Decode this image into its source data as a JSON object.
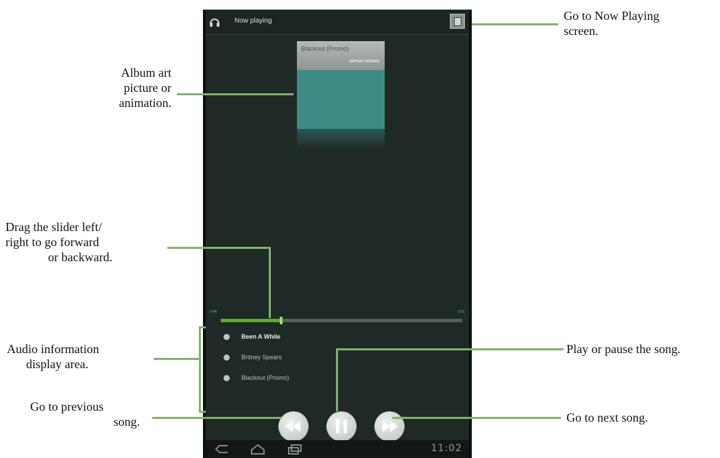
{
  "phone": {
    "title": "Now playing",
    "album_art": {
      "title": "Blackout (Promo)",
      "artist": "BRITNEY SPEARS"
    },
    "progress": {
      "elapsed": "0:48",
      "total": "3:51",
      "fraction": 0.25
    },
    "track_info": [
      {
        "icon": "song-icon",
        "text": "Been A While"
      },
      {
        "icon": "artist-icon",
        "text": "Britney Spears"
      },
      {
        "icon": "album-icon",
        "text": "Blackout (Promo)"
      }
    ],
    "status_bar": {
      "time": "11:02"
    },
    "colors": {
      "accent": "#5fae2e",
      "background": "#1f2926",
      "album": "#3c8c85"
    }
  },
  "callouts": {
    "album_art_l1": "Album art",
    "album_art_l2": "picture or",
    "album_art_l3": "animation.",
    "slider_l1": "Drag the slider left/",
    "slider_l2": "right to go forward",
    "slider_l3": "or backward.",
    "audio_info_l1": "Audio information",
    "audio_info_l2": "display area.",
    "prev_l1": "Go to previous",
    "prev_l2": "song.",
    "now_playing_l1": "Go to Now Playing",
    "now_playing_l2": "screen.",
    "play_pause": "Play or pause the song.",
    "next": "Go to next song."
  }
}
